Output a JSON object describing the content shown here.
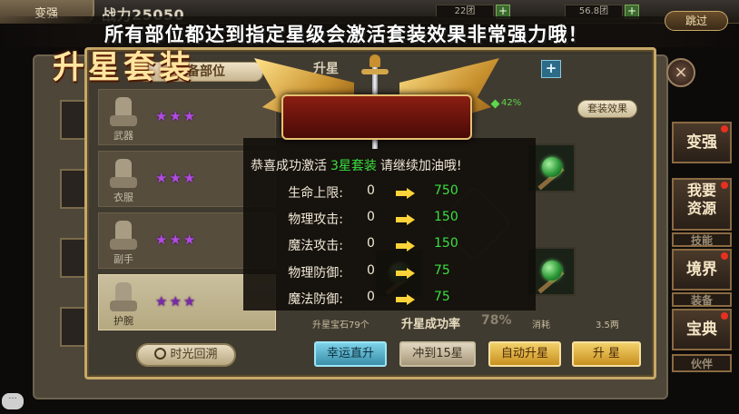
{
  "topbar": {
    "tab_label": "变强",
    "power_label": "战力25050",
    "res1": "22团",
    "res2": "56.8团"
  },
  "banner": {
    "text": "所有部位都达到指定星级会激活套装效果非常强力哦！",
    "skip_label": "跳过"
  },
  "panel": {
    "tab_equip": "装备部位",
    "tab_star": "升星",
    "plus_label": "+",
    "percent": "42%",
    "suit_button": "套装效果",
    "rows": [
      {
        "label": "武器",
        "stars": "★★★"
      },
      {
        "label": "衣服",
        "stars": "★★★"
      },
      {
        "label": "副手",
        "stars": "★★★"
      },
      {
        "label": "护腕",
        "stars": "★★★"
      }
    ],
    "time_back": "时光回溯",
    "stone_label": "升星宝石79个",
    "rate_label": "升星成功率",
    "rate_value": "78%",
    "cost_label": "消耗",
    "price": "3.5两",
    "buttons": {
      "lucky": "幸运直升",
      "to15": "冲到15星",
      "auto": "自动升星",
      "up": "升 星"
    }
  },
  "side": {
    "close": "×",
    "items": [
      "变强",
      "我要资源",
      "境界",
      "宝典"
    ],
    "dim_items": [
      "技能",
      "装备",
      "伙伴"
    ]
  },
  "modal": {
    "title": "升星套装",
    "congrats_pre": "恭喜成功激活",
    "congrats_highlight": "3星套装",
    "congrats_post": "请继续加油哦!",
    "stats": [
      {
        "name": "生命上限:",
        "from": "0",
        "to": "750"
      },
      {
        "name": "物理攻击:",
        "from": "0",
        "to": "150"
      },
      {
        "name": "魔法攻击:",
        "from": "0",
        "to": "150"
      },
      {
        "name": "物理防御:",
        "from": "0",
        "to": "75"
      },
      {
        "name": "魔法防御:",
        "from": "0",
        "to": "75"
      }
    ]
  },
  "chat_icon": "···",
  "colors": {
    "accent_gold": "#c7a868",
    "value_green": "#39e040",
    "star_purple": "#b04ce0"
  }
}
